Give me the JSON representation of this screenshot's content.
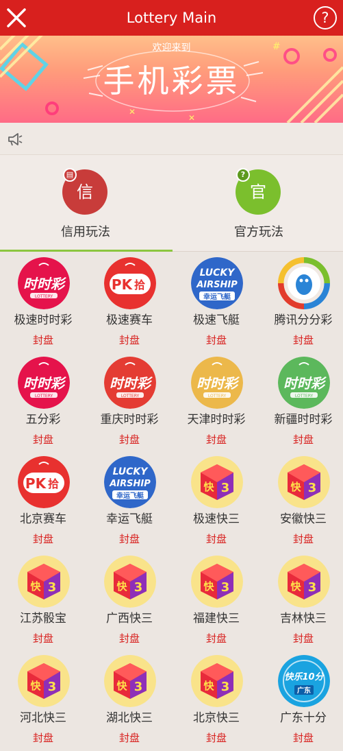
{
  "header": {
    "title": "Lottery Main",
    "help_icon": "?"
  },
  "banner": {
    "welcome": "欢迎来到",
    "title": "手机彩票"
  },
  "tabs": [
    {
      "label": "信用玩法",
      "glyph": "信",
      "color": "#c83c3a",
      "active": true
    },
    {
      "label": "官方玩法",
      "glyph": "官",
      "color": "#7bbf2d",
      "active": false
    }
  ],
  "colors": {
    "header": "#d8201e",
    "accent": "#8cc63f",
    "status": "#d8201e"
  },
  "games": [
    {
      "name": "极速时时彩",
      "status": "封盘",
      "icon": "shishicai-red"
    },
    {
      "name": "极速赛车",
      "status": "封盘",
      "icon": "pk10"
    },
    {
      "name": "极速飞艇",
      "status": "封盘",
      "icon": "lucky-airship"
    },
    {
      "name": "腾讯分分彩",
      "status": "封盘",
      "icon": "qq-penguin"
    },
    {
      "name": "五分彩",
      "status": "封盘",
      "icon": "shishicai-red"
    },
    {
      "name": "重庆时时彩",
      "status": "封盘",
      "icon": "shishicai-redorange"
    },
    {
      "name": "天津时时彩",
      "status": "封盘",
      "icon": "shishicai-yellow"
    },
    {
      "name": "新疆时时彩",
      "status": "封盘",
      "icon": "shishicai-green"
    },
    {
      "name": "北京赛车",
      "status": "封盘",
      "icon": "pk10"
    },
    {
      "name": "幸运飞艇",
      "status": "封盘",
      "icon": "lucky-airship"
    },
    {
      "name": "极速快三",
      "status": "封盘",
      "icon": "kuai3"
    },
    {
      "name": "安徽快三",
      "status": "封盘",
      "icon": "kuai3"
    },
    {
      "name": "江苏骰宝",
      "status": "封盘",
      "icon": "kuai3"
    },
    {
      "name": "广西快三",
      "status": "封盘",
      "icon": "kuai3"
    },
    {
      "name": "福建快三",
      "status": "封盘",
      "icon": "kuai3"
    },
    {
      "name": "吉林快三",
      "status": "封盘",
      "icon": "kuai3"
    },
    {
      "name": "河北快三",
      "status": "封盘",
      "icon": "kuai3"
    },
    {
      "name": "湖北快三",
      "status": "封盘",
      "icon": "kuai3"
    },
    {
      "name": "北京快三",
      "status": "封盘",
      "icon": "kuai3"
    },
    {
      "name": "广东十分",
      "status": "封盘",
      "icon": "kuaile10"
    }
  ]
}
